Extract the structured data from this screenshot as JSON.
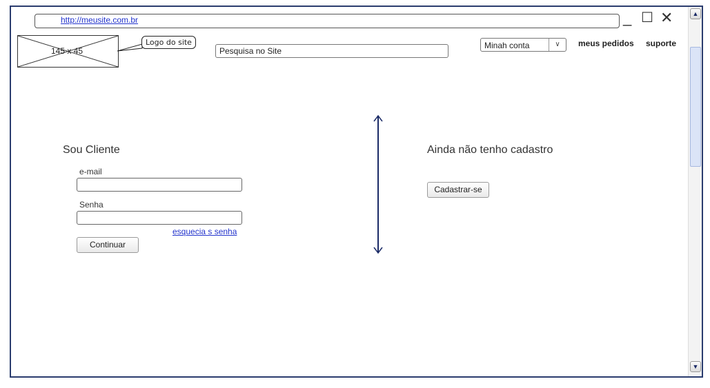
{
  "browser": {
    "url": "http://meusite.com.br",
    "controls": {
      "minimize": "_",
      "maximize": "☐",
      "close": "✕"
    }
  },
  "header": {
    "logo_placeholder": "145 x 45",
    "logo_callout": "Logo do site",
    "search_value": "Pesquisa no Site",
    "account_select": "Minah conta",
    "links": [
      "meus pedidos",
      "suporte"
    ]
  },
  "login": {
    "title": "Sou Cliente",
    "email_label": "e-mail",
    "password_label": "Senha",
    "forgot_link": "esquecia s senha",
    "submit": "Continuar"
  },
  "register": {
    "title": "Ainda não tenho cadastro",
    "button": "Cadastrar-se"
  },
  "scrollbar": {
    "up": "▲",
    "down": "▼"
  },
  "colors": {
    "frame": "#2a3c6e",
    "link": "#2233cc",
    "divider": "#1a2a66"
  }
}
